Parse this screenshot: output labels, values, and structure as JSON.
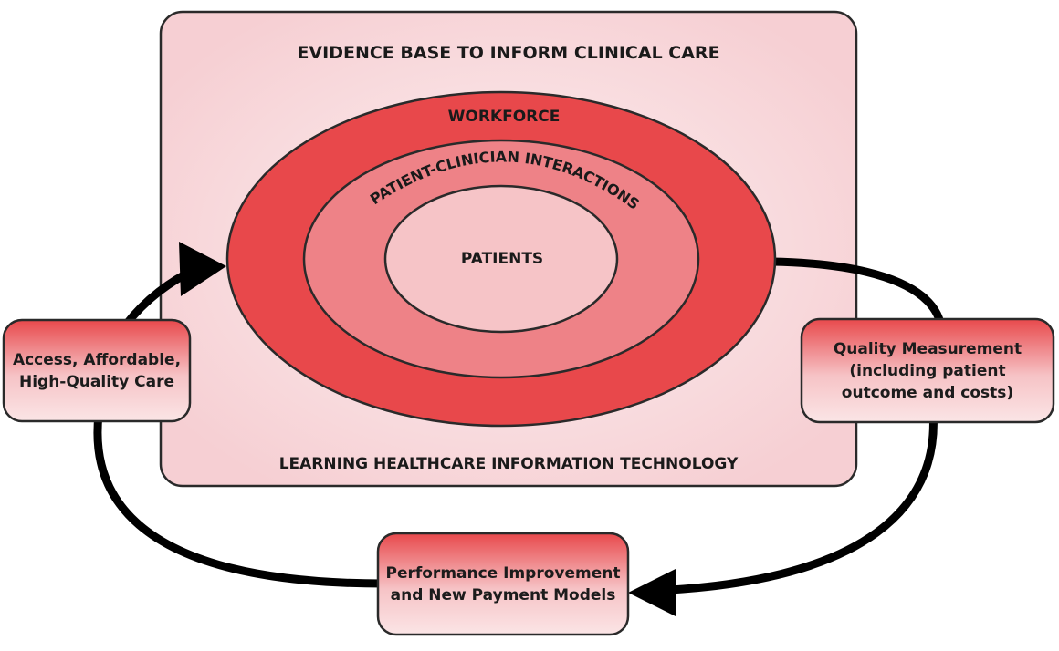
{
  "frame": {
    "top_label": "EVIDENCE BASE TO INFORM CLINICAL CARE",
    "bottom_label": "LEARNING HEALTHCARE INFORMATION TECHNOLOGY"
  },
  "rings": {
    "outer": "WORKFORCE",
    "middle": "PATIENT-CLINICIAN INTERACTIONS",
    "inner": "PATIENTS"
  },
  "boxes": {
    "left": {
      "line1": "Access, Affordable,",
      "line2": "High-Quality Care"
    },
    "right": {
      "line1": "Quality Measurement",
      "line2": "(including patient",
      "line3": "outcome and costs)"
    },
    "bottom": {
      "line1": "Performance Improvement",
      "line2": "and New Payment Models"
    }
  },
  "colors": {
    "frame_fill": "#f7d5d8",
    "outer_ring": "#e8484b",
    "middle_ring": "#ee8287",
    "inner_ring": "#f6c4c7",
    "arrow": "#000000"
  }
}
